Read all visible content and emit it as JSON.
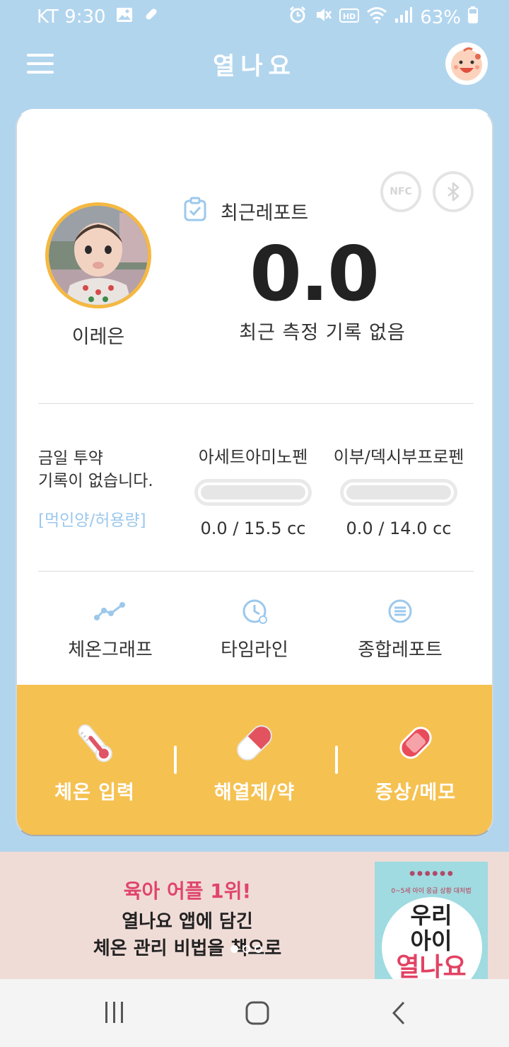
{
  "status_bar": {
    "carrier_time": "KT 9:30",
    "battery": "63%",
    "icons_left": [
      "gallery-icon",
      "pill-icon"
    ],
    "icons_right": [
      "alarm-icon",
      "vibrate-mute-icon",
      "hd-icon",
      "wifi-icon",
      "signal-icon",
      "battery-icon"
    ]
  },
  "app_bar": {
    "title": "열나요",
    "menu_icon": "hamburger-menu-icon",
    "profile_icon": "baby-face-icon"
  },
  "header": {
    "nfc_label": "NFC",
    "bluetooth_icon": "bluetooth-icon"
  },
  "child": {
    "name": "이레은"
  },
  "report": {
    "label": "최근레포트",
    "temperature": "0.0",
    "status": "최근 측정 기록 없음"
  },
  "medication": {
    "none_line1": "금일 투약",
    "none_line2": "기록이 없습니다.",
    "dose_link": "[먹인양/허용량]",
    "drugs": [
      {
        "name": "아세트아미노펜",
        "amount": "0.0 / 15.5 cc",
        "progress": 0
      },
      {
        "name": "이부/덱시부프로펜",
        "amount": "0.0 / 14.0 cc",
        "progress": 0
      }
    ]
  },
  "nav": [
    {
      "label": "체온그래프",
      "icon": "line-graph-icon"
    },
    {
      "label": "타임라인",
      "icon": "clock-icon"
    },
    {
      "label": "종합레포트",
      "icon": "list-circle-icon"
    }
  ],
  "actions": [
    {
      "label": "체온 입력",
      "icon": "thermometer-icon"
    },
    {
      "label": "해열제/약",
      "icon": "capsule-icon"
    },
    {
      "label": "증상/메모",
      "icon": "bandage-icon"
    }
  ],
  "banner": {
    "line1": "육아 어플 1위!",
    "line2": "열나요 앱에 담긴",
    "line3": "체온 관리 비법을 책으로",
    "book_title_1": "우리",
    "book_title_2": "아이",
    "book_title_3": "열나요",
    "book_subtitle": "0~5세 아이 응급 상황 대처법"
  },
  "system_nav": [
    "recents-icon",
    "home-icon",
    "back-icon"
  ],
  "colors": {
    "background": "#b2d5ee",
    "accent_yellow": "#f5c151",
    "link_blue": "#9cc8ec",
    "banner_pink": "#e0456b",
    "photo_ring": "#f5b841"
  }
}
